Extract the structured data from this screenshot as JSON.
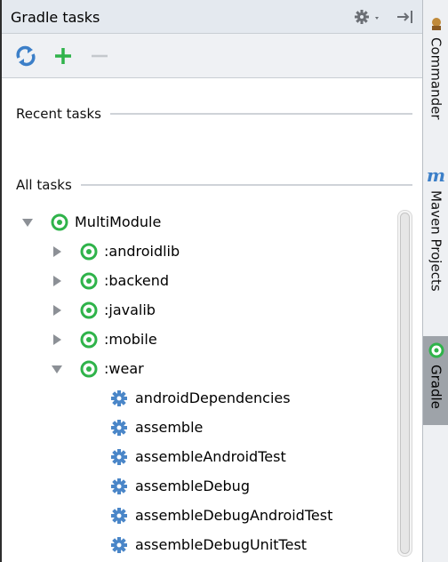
{
  "panel": {
    "title": "Gradle tasks"
  },
  "toolbar": {
    "refresh_icon": "refresh-icon",
    "add_icon": "plus-icon",
    "remove_icon": "minus-icon"
  },
  "sections": {
    "recent": "Recent tasks",
    "all": "All tasks"
  },
  "tree": {
    "root": {
      "label": "MultiModule",
      "expanded": true
    },
    "modules": [
      {
        "label": ":androidlib",
        "expanded": false
      },
      {
        "label": ":backend",
        "expanded": false
      },
      {
        "label": ":javalib",
        "expanded": false
      },
      {
        "label": ":mobile",
        "expanded": false
      },
      {
        "label": ":wear",
        "expanded": true
      }
    ],
    "tasks": [
      "androidDependencies",
      "assemble",
      "assembleAndroidTest",
      "assembleDebug",
      "assembleDebugAndroidTest",
      "assembleDebugUnitTest"
    ]
  },
  "side_tabs": {
    "commander": "Commander",
    "maven_glyph": "m",
    "maven": "Maven Projects",
    "gradle": "Gradle"
  },
  "colors": {
    "gradle_green": "#2fb34a",
    "refresh_blue": "#3c7fc8",
    "task_blue": "#4a86c8"
  }
}
